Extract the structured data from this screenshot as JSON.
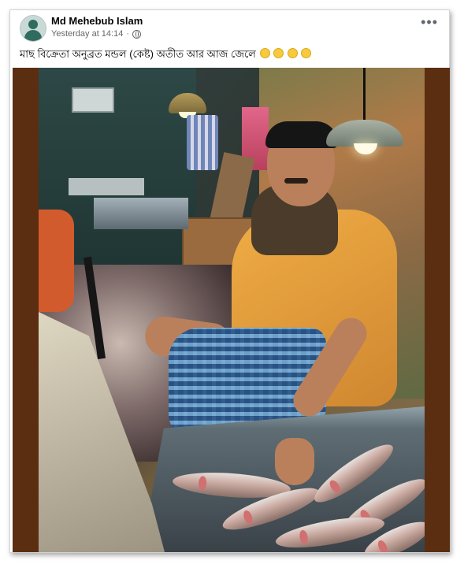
{
  "post": {
    "author_name": "Md Mehebub Islam",
    "timestamp": "Yesterday at 14:14",
    "separator": "·",
    "more_options": "•••",
    "caption_text": "মাছ বিক্রেতা অনুব্রত মন্ডল (কেষ্ট) অতীত আর আজ জেলে",
    "caption_emojis": [
      "slightly-smiling-face",
      "slightly-smiling-face",
      "crying-face",
      "crying-face"
    ],
    "audience_icon": "globe-icon"
  },
  "photo": {
    "subject": "fish-market-photo"
  },
  "colors": {
    "card_border": "#d4d4d4",
    "author_text": "#050505",
    "meta_text": "#65676b",
    "photo_border": "#5b2e12"
  }
}
